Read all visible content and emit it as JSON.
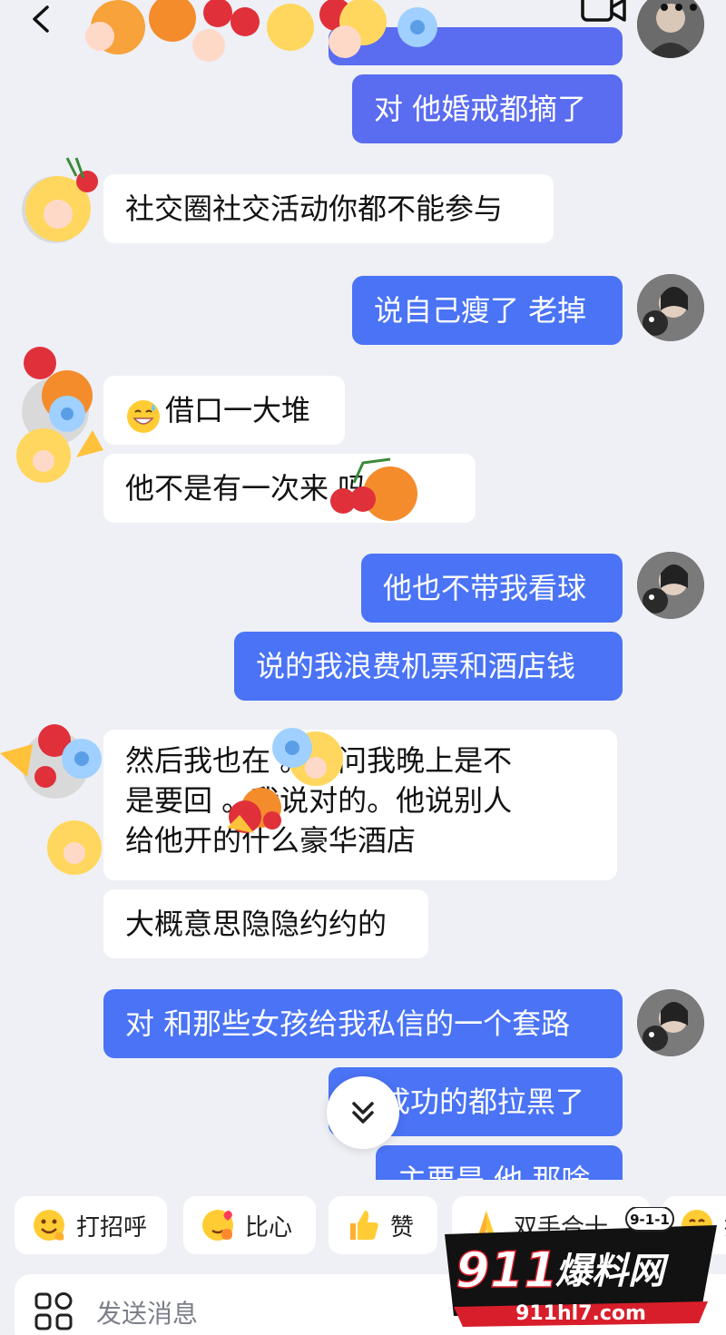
{
  "messages": [
    {
      "side": "out",
      "text": "对 他婚戒都摘了"
    },
    {
      "side": "in",
      "text": "社交圈社交活动你都不能参与"
    },
    {
      "side": "out",
      "text": "说自己瘦了 老掉"
    },
    {
      "side": "in",
      "text": "借口一大堆",
      "emoji": "grin-sweat-emoji"
    },
    {
      "side": "in",
      "text": "他不是有一次来 吗。"
    },
    {
      "side": "out",
      "text": "他也不带我看球"
    },
    {
      "side": "out",
      "text": "说的我浪费机票和酒店钱"
    },
    {
      "side": "in",
      "lines": [
        "然后我也在 。他问我晚上是不",
        "是要回 。我说对的。他说别人",
        "给他开的什么豪华酒店"
      ]
    },
    {
      "side": "in",
      "text": "大概意思隐隐约约的"
    },
    {
      "side": "out",
      "text": "对 和那些女孩给我私信的一个套路"
    },
    {
      "side": "out",
      "text": "成功的都拉黑了"
    },
    {
      "side": "out",
      "text": "主要是 他 那啥"
    }
  ],
  "quick_replies": [
    {
      "label": "打招呼",
      "icon": "wave-emoji"
    },
    {
      "label": "比心",
      "icon": "finger-heart-emoji"
    },
    {
      "label": "赞",
      "icon": "thumbs-up-emoji"
    },
    {
      "label": "双手合十",
      "icon": "pray-emoji"
    },
    {
      "label": "抱",
      "icon": "hug-emoji"
    }
  ],
  "input": {
    "placeholder": "发送消息"
  },
  "watermark": {
    "badge": "9-1-1",
    "brand_number": "911",
    "brand_text": "爆料网",
    "url": "911hl7.com"
  },
  "colors": {
    "background": "#eef0f5",
    "outgoing_bubble": "#4a73f5",
    "incoming_bubble": "#ffffff"
  }
}
